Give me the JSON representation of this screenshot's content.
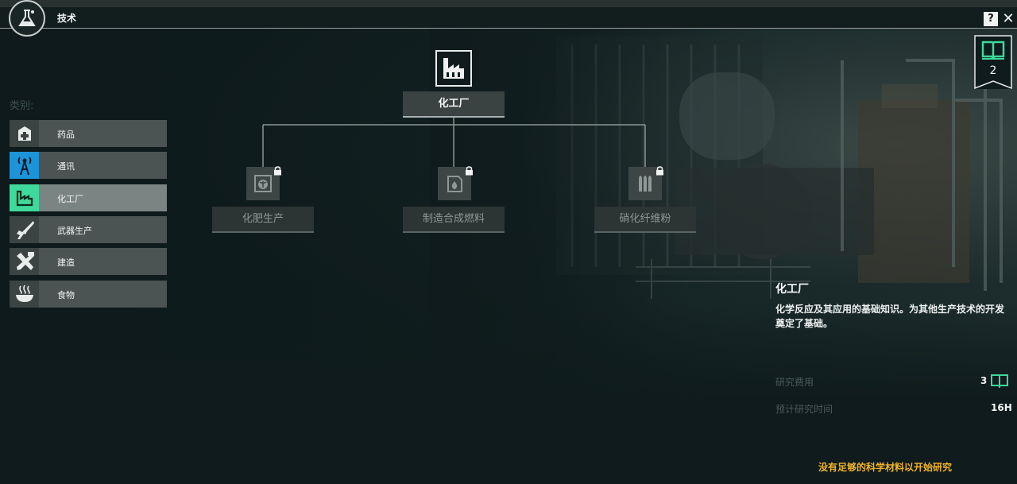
{
  "window": {
    "title": "技术",
    "help_label": "?",
    "close_label": "✕"
  },
  "top_strip": {
    "text": ""
  },
  "research_points": {
    "count": "2",
    "icon": "book-icon"
  },
  "categories": {
    "label": "类别:",
    "items": [
      {
        "label": "药品",
        "icon": "medkit-icon",
        "active": false
      },
      {
        "label": "通讯",
        "icon": "antenna-icon",
        "active": false
      },
      {
        "label": "化工厂",
        "icon": "factory-icon",
        "active": true
      },
      {
        "label": "武器生产",
        "icon": "rifle-icon",
        "active": false
      },
      {
        "label": "建造",
        "icon": "tools-icon",
        "active": false
      },
      {
        "label": "食物",
        "icon": "soup-icon",
        "active": false
      }
    ]
  },
  "tree": {
    "root": {
      "label": "化工厂",
      "icon": "factory-icon"
    },
    "children": [
      {
        "label": "化肥生产",
        "icon": "fertilizer-icon",
        "locked": true
      },
      {
        "label": "制造合成燃料",
        "icon": "fuel-can-icon",
        "locked": true
      },
      {
        "label": "硝化纤维粉",
        "icon": "ammo-icon",
        "locked": true
      }
    ]
  },
  "details": {
    "title": "化工厂",
    "description": "化学反应及其应用的基础知识。为其他生产技术的开发奠定了基础。",
    "cost_label": "研究费用",
    "cost_value": "3",
    "time_label": "预计研究时间",
    "time_value": "16H",
    "warning": "没有足够的科学材料以开始研究"
  },
  "colors": {
    "accent": "#3fd99b",
    "comm_blue": "#1d93d8",
    "warning": "#f0b429",
    "background": "#0f1b1c"
  }
}
